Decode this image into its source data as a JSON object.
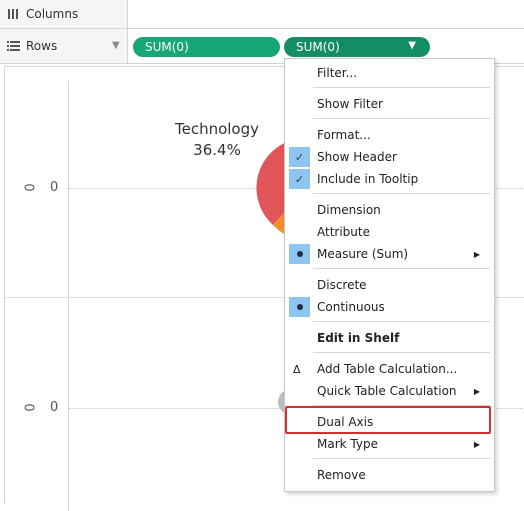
{
  "shelves": {
    "columns_label": "Columns",
    "rows_label": "Rows",
    "rows_pills": [
      "SUM(0)",
      "SUM(0)"
    ]
  },
  "view": {
    "axis_ticks": [
      "0",
      "0"
    ],
    "axis_labels": [
      "0",
      "0"
    ],
    "pie_label_name": "Technology",
    "pie_label_pct": "36.4%",
    "pie_colors": [
      "#e15759",
      "#f28e2b",
      "#4e79a7"
    ]
  },
  "menu": {
    "items": [
      {
        "label": "Filter..."
      },
      {
        "label": "Show Filter"
      },
      {
        "label": "Format..."
      },
      {
        "label": "Show Header",
        "checked": true
      },
      {
        "label": "Include in Tooltip",
        "checked": true
      },
      {
        "label": "Dimension"
      },
      {
        "label": "Attribute"
      },
      {
        "label": "Measure (Sum)",
        "selected": true,
        "submenu": true
      },
      {
        "label": "Discrete"
      },
      {
        "label": "Continuous",
        "selected": true
      },
      {
        "label": "Edit in Shelf"
      },
      {
        "label": "Add Table Calculation..."
      },
      {
        "label": "Quick Table Calculation",
        "submenu": true
      },
      {
        "label": "Dual Axis",
        "highlighted": true
      },
      {
        "label": "Mark Type",
        "submenu": true
      },
      {
        "label": "Remove"
      }
    ],
    "check_glyph": "✓",
    "delta_glyph": "Δ",
    "arrow_glyph": "▶"
  },
  "colors": {
    "pill_green": "#17a775",
    "pill_green_active": "#138d62",
    "highlight_red": "#d32f2f",
    "menu_gutter_blue": "#8fc4ee"
  }
}
